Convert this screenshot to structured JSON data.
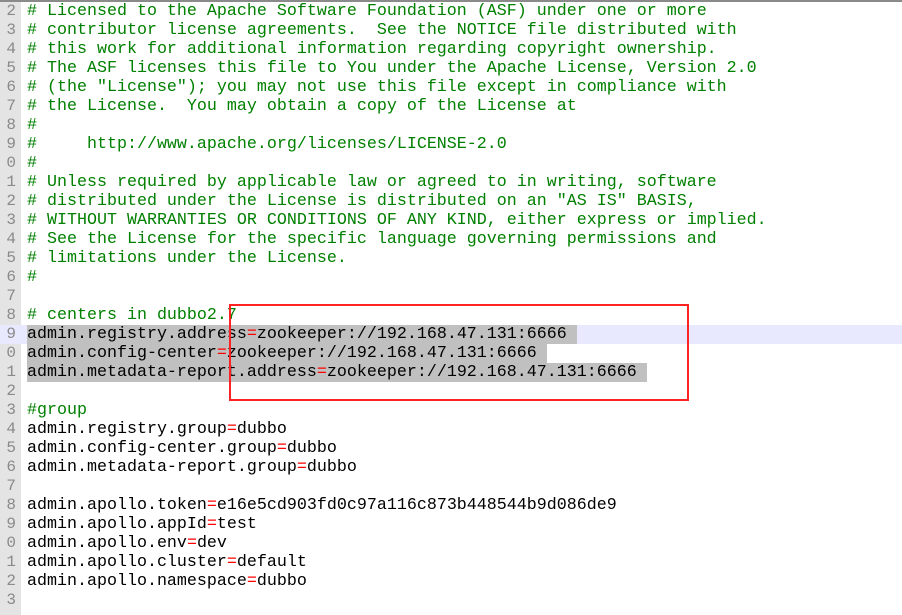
{
  "editor": {
    "highlight_color": "#c0c0c0",
    "current_line_color": "#e8e8ff",
    "annotation_box_color": "#ff2222",
    "lines": [
      {
        "n": "2",
        "sel": false,
        "seg": [
          {
            "c": "comment",
            "t": "# Licensed to the Apache Software Foundation (ASF) under one or more"
          }
        ]
      },
      {
        "n": "3",
        "sel": false,
        "seg": [
          {
            "c": "comment",
            "t": "# contributor license agreements.  See the NOTICE file distributed with"
          }
        ]
      },
      {
        "n": "4",
        "sel": false,
        "seg": [
          {
            "c": "comment",
            "t": "# this work for additional information regarding copyright ownership."
          }
        ]
      },
      {
        "n": "5",
        "sel": false,
        "seg": [
          {
            "c": "comment",
            "t": "# The ASF licenses this file to You under the Apache License, Version 2.0"
          }
        ]
      },
      {
        "n": "6",
        "sel": false,
        "seg": [
          {
            "c": "comment",
            "t": "# (the \"License\"); you may not use this file except in compliance with"
          }
        ]
      },
      {
        "n": "7",
        "sel": false,
        "seg": [
          {
            "c": "comment",
            "t": "# the License.  You may obtain a copy of the License at"
          }
        ]
      },
      {
        "n": "8",
        "sel": false,
        "seg": [
          {
            "c": "comment",
            "t": "#"
          }
        ]
      },
      {
        "n": "9",
        "sel": false,
        "seg": [
          {
            "c": "comment",
            "t": "#     http://www.apache.org/licenses/LICENSE-2.0"
          }
        ]
      },
      {
        "n": "0",
        "sel": false,
        "seg": [
          {
            "c": "comment",
            "t": "#"
          }
        ]
      },
      {
        "n": "1",
        "sel": false,
        "seg": [
          {
            "c": "comment",
            "t": "# Unless required by applicable law or agreed to in writing, software"
          }
        ]
      },
      {
        "n": "2",
        "sel": false,
        "seg": [
          {
            "c": "comment",
            "t": "# distributed under the License is distributed on an \"AS IS\" BASIS,"
          }
        ]
      },
      {
        "n": "3",
        "sel": false,
        "seg": [
          {
            "c": "comment",
            "t": "# WITHOUT WARRANTIES OR CONDITIONS OF ANY KIND, either express or implied."
          }
        ]
      },
      {
        "n": "4",
        "sel": false,
        "seg": [
          {
            "c": "comment",
            "t": "# See the License for the specific language governing permissions and"
          }
        ]
      },
      {
        "n": "5",
        "sel": false,
        "seg": [
          {
            "c": "comment",
            "t": "# limitations under the License."
          }
        ]
      },
      {
        "n": "6",
        "sel": false,
        "seg": [
          {
            "c": "comment",
            "t": "#"
          }
        ]
      },
      {
        "n": "7",
        "sel": false,
        "seg": []
      },
      {
        "n": "8",
        "sel": false,
        "seg": [
          {
            "c": "comment",
            "t": "# centers in dubbo2.7"
          }
        ]
      },
      {
        "n": "9",
        "sel": true,
        "current": true,
        "seg": [
          {
            "c": "key",
            "t": "admin.registry.address"
          },
          {
            "c": "op",
            "t": "="
          },
          {
            "c": "val",
            "t": "zookeeper://192.168.47.131:6666"
          }
        ]
      },
      {
        "n": "0",
        "sel": true,
        "seg": [
          {
            "c": "key",
            "t": "admin.config-center"
          },
          {
            "c": "op",
            "t": "="
          },
          {
            "c": "val",
            "t": "zookeeper://192.168.47.131:6666"
          }
        ]
      },
      {
        "n": "1",
        "sel": true,
        "seg": [
          {
            "c": "key",
            "t": "admin.metadata-report.address"
          },
          {
            "c": "op",
            "t": "="
          },
          {
            "c": "val",
            "t": "zookeeper://192.168.47.131:6666"
          }
        ]
      },
      {
        "n": "2",
        "sel": false,
        "seg": []
      },
      {
        "n": "3",
        "sel": false,
        "seg": [
          {
            "c": "comment",
            "t": "#group"
          }
        ]
      },
      {
        "n": "4",
        "sel": false,
        "seg": [
          {
            "c": "key",
            "t": "admin.registry.group"
          },
          {
            "c": "op",
            "t": "="
          },
          {
            "c": "val",
            "t": "dubbo"
          }
        ]
      },
      {
        "n": "5",
        "sel": false,
        "seg": [
          {
            "c": "key",
            "t": "admin.config-center.group"
          },
          {
            "c": "op",
            "t": "="
          },
          {
            "c": "val",
            "t": "dubbo"
          }
        ]
      },
      {
        "n": "6",
        "sel": false,
        "seg": [
          {
            "c": "key",
            "t": "admin.metadata-report.group"
          },
          {
            "c": "op",
            "t": "="
          },
          {
            "c": "val",
            "t": "dubbo"
          }
        ]
      },
      {
        "n": "7",
        "sel": false,
        "seg": []
      },
      {
        "n": "8",
        "sel": false,
        "seg": [
          {
            "c": "key",
            "t": "admin.apollo.token"
          },
          {
            "c": "op",
            "t": "="
          },
          {
            "c": "val",
            "t": "e16e5cd903fd0c97a116c873b448544b9d086de9"
          }
        ]
      },
      {
        "n": "9",
        "sel": false,
        "seg": [
          {
            "c": "key",
            "t": "admin.apollo.appId"
          },
          {
            "c": "op",
            "t": "="
          },
          {
            "c": "val",
            "t": "test"
          }
        ]
      },
      {
        "n": "0",
        "sel": false,
        "seg": [
          {
            "c": "key",
            "t": "admin.apollo.env"
          },
          {
            "c": "op",
            "t": "="
          },
          {
            "c": "val",
            "t": "dev"
          }
        ]
      },
      {
        "n": "1",
        "sel": false,
        "seg": [
          {
            "c": "key",
            "t": "admin.apollo.cluster"
          },
          {
            "c": "op",
            "t": "="
          },
          {
            "c": "val",
            "t": "default"
          }
        ]
      },
      {
        "n": "2",
        "sel": false,
        "seg": [
          {
            "c": "key",
            "t": "admin.apollo.namespace"
          },
          {
            "c": "op",
            "t": "="
          },
          {
            "c": "val",
            "t": "dubbo"
          }
        ]
      },
      {
        "n": "3",
        "sel": false,
        "seg": []
      }
    ]
  }
}
